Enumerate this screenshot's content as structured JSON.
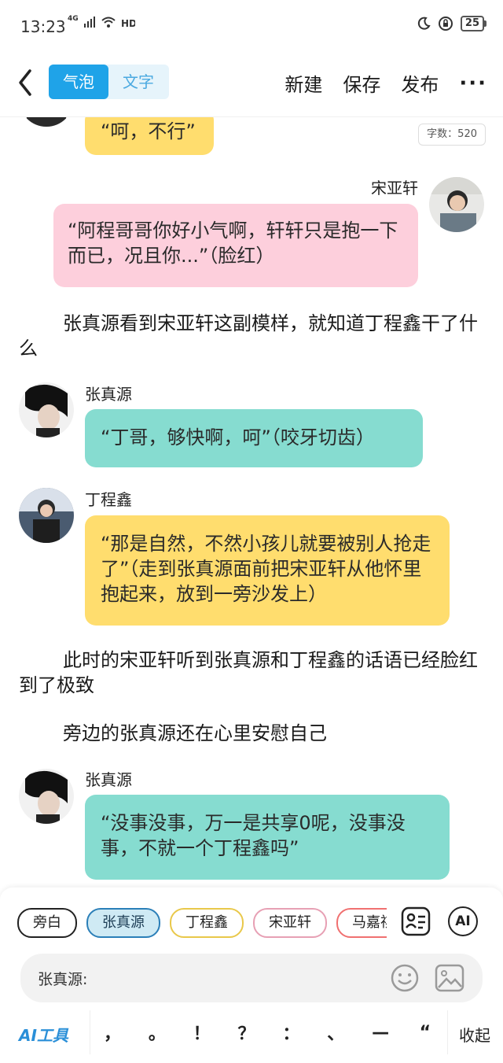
{
  "status": {
    "time": "13:23",
    "network": "4G",
    "battery": "25"
  },
  "toolbar": {
    "mode_bubble": "气泡",
    "mode_text": "文字",
    "new": "新建",
    "save": "保存",
    "publish": "发布",
    "more": "···"
  },
  "word_count": "字数：520",
  "messages": {
    "m0": {
      "text": "“呵，不行”"
    },
    "m1": {
      "speaker": "宋亚轩",
      "text": "“阿程哥哥你好小气啊，轩轩只是抱一下而已，况且你...”（脸红）"
    },
    "n1": {
      "text": "张真源看到宋亚轩这副模样，就知道丁程鑫干了什么"
    },
    "m2": {
      "speaker": "张真源",
      "text": "“丁哥，够快啊，呵”（咬牙切齿）"
    },
    "m3": {
      "speaker": "丁程鑫",
      "text": "“那是自然，不然小孩儿就要被别人抢走了”（走到张真源面前把宋亚轩从他怀里抱起来，放到一旁沙发上）"
    },
    "n2": {
      "text": "此时的宋亚轩听到张真源和丁程鑫的话语已经脸红到了极致"
    },
    "n3": {
      "text": "旁边的张真源还在心里安慰自己"
    },
    "m4": {
      "speaker": "张真源",
      "text": "“没事没事，万一是共享0呢，没事没事，不就一个丁程鑫吗”"
    }
  },
  "characters": {
    "c0": "旁白",
    "c1": "张真源",
    "c2": "丁程鑫",
    "c3": "宋亚轩",
    "c4": "马嘉祺"
  },
  "input": {
    "value": "张真源:"
  },
  "bottom": {
    "ai_tool": "AI工具",
    "ai_label": "AI",
    "collapse": "收起",
    "punct": {
      "p0": "，",
      "p1": "。",
      "p2": "！",
      "p3": "？",
      "p4": "：",
      "p5": "、",
      "p6": "—",
      "p7": "“"
    }
  },
  "colors": {
    "accent": "#1fa3e8",
    "bubble_yellow": "#ffdd6e",
    "bubble_pink": "#fdcfdc",
    "bubble_teal": "#86dcd0"
  },
  "icons": [
    "back-chevron-icon",
    "signal-icon",
    "wifi-icon",
    "hd-icon",
    "moon-icon",
    "lock-icon",
    "battery-icon",
    "profile-card-icon",
    "ai-icon",
    "emoji-icon",
    "image-icon"
  ]
}
